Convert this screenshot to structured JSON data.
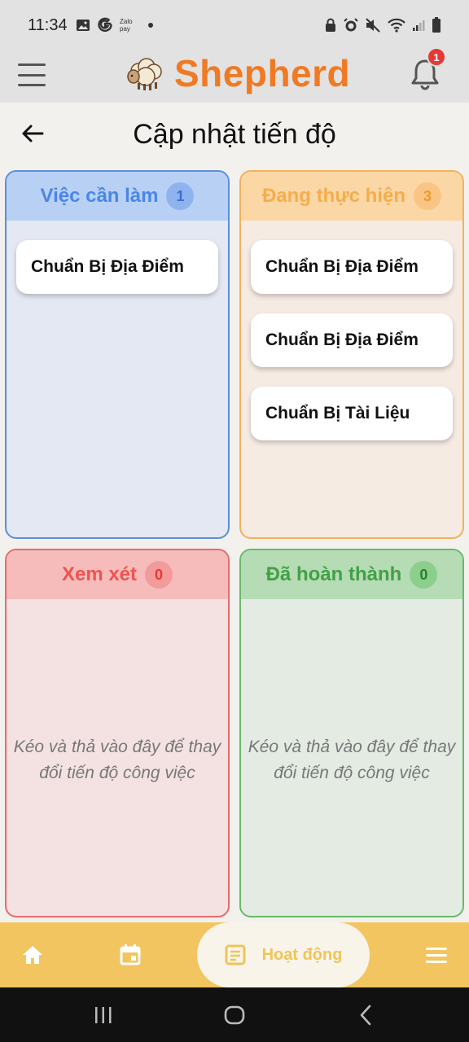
{
  "status_bar": {
    "time": "11:34",
    "left_icons": [
      "image-icon",
      "g-icon",
      "zalopay-icon",
      "dot-icon"
    ],
    "right_icons": [
      "lock-icon",
      "alarm-icon",
      "mute-icon",
      "wifi-icon",
      "signal-icon",
      "battery-icon"
    ],
    "zalo_label": "Zalo pay"
  },
  "header": {
    "app_name": "Shepherd",
    "notification_count": "1",
    "brand_color": "#f07a24"
  },
  "page": {
    "title": "Cập nhật tiến độ"
  },
  "columns": {
    "todo": {
      "title": "Việc cần làm",
      "count": "1",
      "cards": [
        "Chuẩn Bị Địa Điểm"
      ]
    },
    "doing": {
      "title": "Đang thực hiện",
      "count": "3",
      "cards": [
        "Chuẩn Bị Địa Điểm",
        "Chuẩn Bị Địa Điểm",
        "Chuẩn Bị Tài Liệu"
      ]
    },
    "review": {
      "title": "Xem xét",
      "count": "0",
      "empty_hint": "Kéo và thả vào đây để thay đổi tiến độ công việc"
    },
    "done": {
      "title": "Đã hoàn thành",
      "count": "0",
      "empty_hint": "Kéo và thả vào đây để thay đổi tiến độ công việc"
    }
  },
  "bottom_nav": {
    "items": [
      {
        "icon": "home-icon"
      },
      {
        "icon": "calendar-icon"
      },
      {
        "icon": "activity-icon",
        "label": "Hoạt động",
        "active": true
      },
      {
        "icon": "menu-icon"
      }
    ]
  }
}
